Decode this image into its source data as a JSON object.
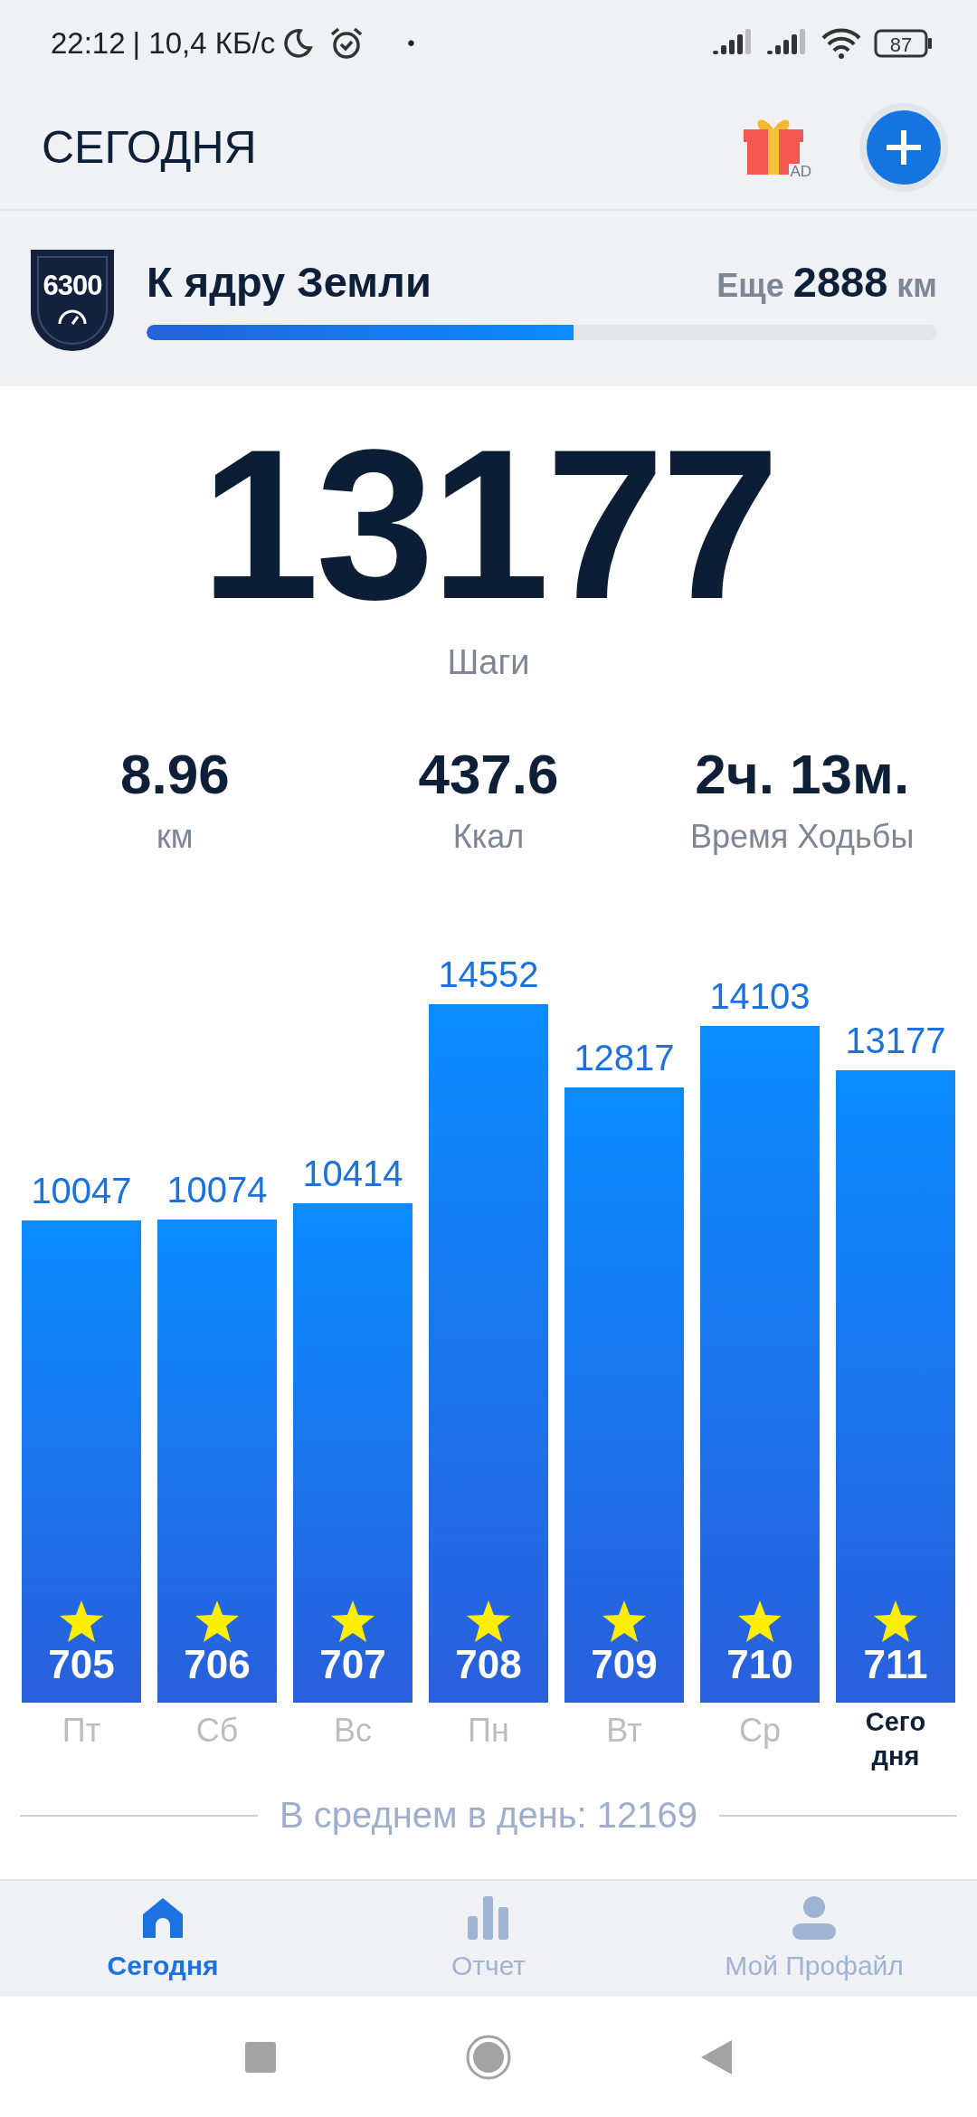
{
  "status_bar": {
    "time": "22:12",
    "speed": "| 10,4 КБ/с",
    "dot": "•",
    "battery": "87"
  },
  "header": {
    "title": "СЕГОДНЯ",
    "ad_badge": "AD"
  },
  "goal": {
    "badge": "6300",
    "title": "К ядру Земли",
    "remaining_prefix": "Еще",
    "remaining_value": "2888",
    "remaining_unit": "км",
    "level": 0.54
  },
  "steps": {
    "value": "13177",
    "label": "Шаги"
  },
  "stats": [
    {
      "value": "8.96",
      "label": "км"
    },
    {
      "value": "437.6",
      "label": "Ккал"
    },
    {
      "value": "2ч. 13м.",
      "label": "Время Ходьбы"
    }
  ],
  "chart_data": {
    "type": "bar",
    "categories": [
      "Пт",
      "Сб",
      "Вс",
      "Пн",
      "Вт",
      "Ср",
      "Сегодня"
    ],
    "values": [
      10047,
      10074,
      10414,
      14552,
      12817,
      14103,
      13177
    ],
    "data_labels": true
  },
  "days": [
    {
      "badge": "705",
      "selected": false
    },
    {
      "badge": "706",
      "selected": false
    },
    {
      "badge": "707",
      "selected": false
    },
    {
      "badge": "708",
      "selected": false
    },
    {
      "badge": "709",
      "selected": false
    },
    {
      "badge": "710",
      "selected": false
    },
    {
      "badge": "711",
      "selected": true
    }
  ],
  "average": "В среднем в день: 12169",
  "nav": [
    {
      "label": "Сегодня",
      "selected": true
    },
    {
      "label": "Отчет",
      "selected": false
    },
    {
      "label": "Мой Профайл",
      "selected": false
    }
  ]
}
